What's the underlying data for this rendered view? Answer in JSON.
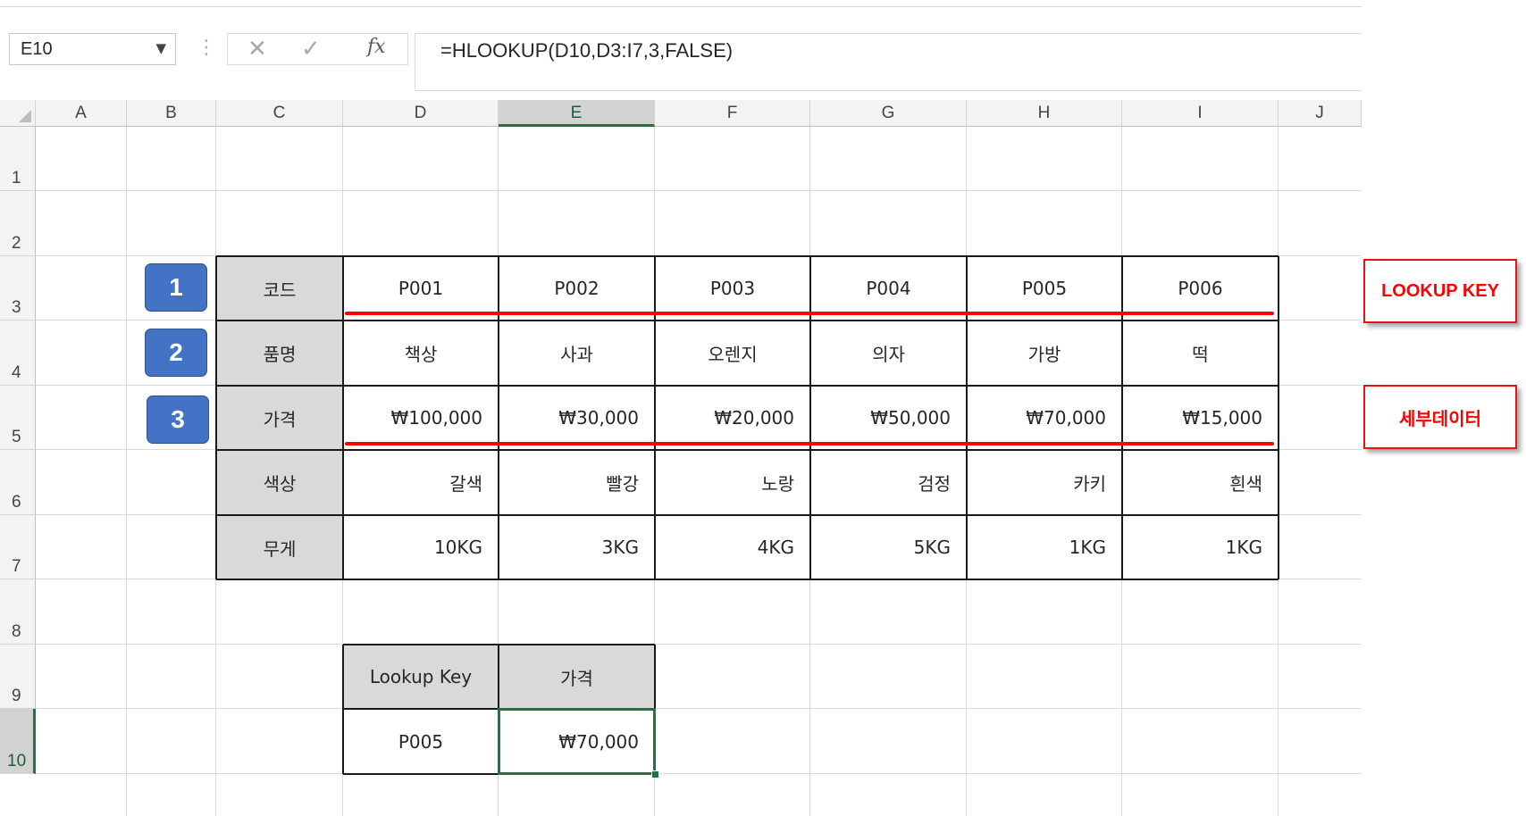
{
  "formula_bar": {
    "name_box": "E10",
    "name_box_arrow": "▼",
    "separator_dots": "⋮",
    "cancel_glyph": "✕",
    "enter_glyph": "✓",
    "fx_glyph": "fx",
    "formula": "=HLOOKUP(D10,D3:I7,3,FALSE)"
  },
  "sheet": {
    "columns": [
      "A",
      "B",
      "C",
      "D",
      "E",
      "F",
      "G",
      "H",
      "I",
      "J"
    ],
    "rows": [
      "1",
      "2",
      "3",
      "4",
      "5",
      "6",
      "7",
      "8",
      "9",
      "10"
    ],
    "active_cell": "E10"
  },
  "data_table": {
    "row_labels": [
      "코드",
      "품명",
      "가격",
      "색상",
      "무게"
    ],
    "codes": [
      "P001",
      "P002",
      "P003",
      "P004",
      "P005",
      "P006"
    ],
    "names": [
      "책상",
      "사과",
      "오렌지",
      "의자",
      "가방",
      "떡"
    ],
    "prices": [
      "₩100,000",
      "₩30,000",
      "₩20,000",
      "₩50,000",
      "₩70,000",
      "₩15,000"
    ],
    "colors": [
      "갈색",
      "빨강",
      "노랑",
      "검정",
      "카키",
      "흰색"
    ],
    "weights": [
      "10KG",
      "3KG",
      "4KG",
      "5KG",
      "1KG",
      "1KG"
    ]
  },
  "lookup_table": {
    "key_header": "Lookup Key",
    "result_header": "가격",
    "key_value": "P005",
    "result_value": "₩70,000"
  },
  "annotations": {
    "badges": [
      "1",
      "2",
      "3"
    ],
    "callout_lookup_key": "LOOKUP KEY",
    "callout_detail_data": "세부데이터",
    "accent_color": "#4472c4",
    "highlight_color": "#ff0000",
    "selection_color": "#217346"
  }
}
